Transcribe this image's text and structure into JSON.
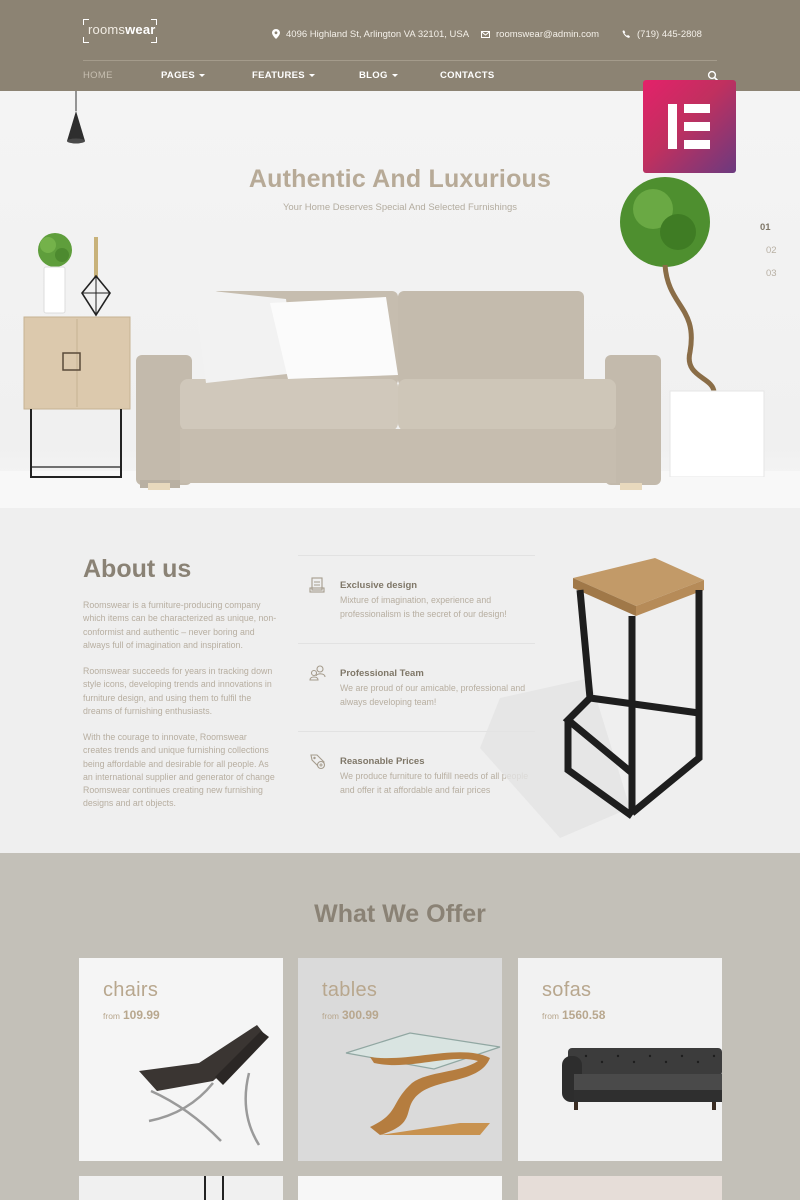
{
  "header": {
    "logo": {
      "left": "rooms",
      "right": "wear"
    },
    "address": "4096 Highland St, Arlington VA 32101, USA",
    "email": "roomswear@admin.com",
    "phone": "(719) 445-2808",
    "nav": [
      {
        "label": "HOME",
        "active": true
      },
      {
        "label": "PAGES",
        "dropdown": true
      },
      {
        "label": "FEATURES",
        "dropdown": true
      },
      {
        "label": "BLOG",
        "dropdown": true
      },
      {
        "label": "CONTACTS"
      }
    ]
  },
  "hero": {
    "title": "Authentic And Luxurious",
    "subtitle": "Your Home Deserves Special And Selected Furnishings",
    "slides": [
      "01",
      "02",
      "03"
    ],
    "active_slide": "01"
  },
  "about": {
    "title": "About us",
    "paragraphs": [
      "Roomswear is a furniture-producing company which items can be characterized as unique, non-conformist and authentic – never boring and always full of imagination and inspiration.",
      "Roomswear succeeds for years in tracking down style icons, developing trends and innovations in furniture design, and using them to fulfil the dreams of furnishing enthusiasts.",
      "With the courage to innovate, Roomswear creates trends and unique furnishing collections being affordable and desirable for all people. As an international supplier and generator of change Roomswear continues creating new furnishing designs and art objects."
    ],
    "features": [
      {
        "icon": "design-box-icon",
        "title": "Exclusive design",
        "desc": "Mixture of imagination, experience and professionalism is the secret of our design!"
      },
      {
        "icon": "team-icon",
        "title": "Professional Team",
        "desc": "We are proud of our amicable, professional and always developing team!"
      },
      {
        "icon": "price-tag-icon",
        "title": "Reasonable Prices",
        "desc": "We produce furniture to fulfill needs of all people and offer it at affordable and fair prices"
      }
    ]
  },
  "offer": {
    "title": "What We Offer",
    "from_label": "from",
    "cards": [
      {
        "name": "chairs",
        "price": "109.99"
      },
      {
        "name": "tables",
        "price": "300.99"
      },
      {
        "name": "sofas",
        "price": "1560.58"
      }
    ]
  },
  "colors": {
    "header_bg": "#8c8373",
    "accent_text": "#b7aa97",
    "section_bg": "#efefef",
    "offer_bg": "#c3c0b8",
    "elementor_brand": "#d6275f"
  }
}
